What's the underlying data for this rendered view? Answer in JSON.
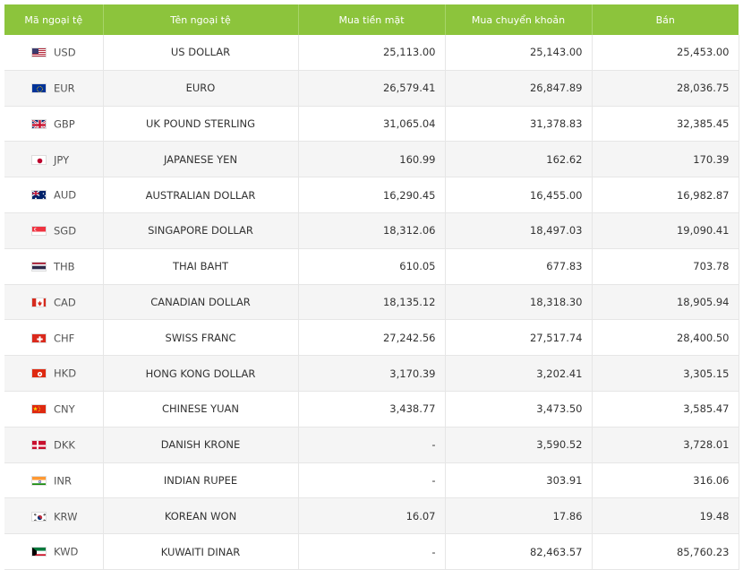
{
  "headers": [
    "Mã ngoại tệ",
    "Tên ngoại tệ",
    "Mua tiền mặt",
    "Mua chuyển khoản",
    "Bán"
  ],
  "rows": [
    {
      "code": "USD",
      "name": "US DOLLAR",
      "cash": "25,113.00",
      "transfer": "25,143.00",
      "sell": "25,453.00",
      "flag": "us-flag-icon"
    },
    {
      "code": "EUR",
      "name": "EURO",
      "cash": "26,579.41",
      "transfer": "26,847.89",
      "sell": "28,036.75",
      "flag": "eu-flag-icon"
    },
    {
      "code": "GBP",
      "name": "UK POUND STERLING",
      "cash": "31,065.04",
      "transfer": "31,378.83",
      "sell": "32,385.45",
      "flag": "uk-flag-icon"
    },
    {
      "code": "JPY",
      "name": "JAPANESE YEN",
      "cash": "160.99",
      "transfer": "162.62",
      "sell": "170.39",
      "flag": "jp-flag-icon"
    },
    {
      "code": "AUD",
      "name": "AUSTRALIAN DOLLAR",
      "cash": "16,290.45",
      "transfer": "16,455.00",
      "sell": "16,982.87",
      "flag": "au-flag-icon"
    },
    {
      "code": "SGD",
      "name": "SINGAPORE DOLLAR",
      "cash": "18,312.06",
      "transfer": "18,497.03",
      "sell": "19,090.41",
      "flag": "sg-flag-icon"
    },
    {
      "code": "THB",
      "name": "THAI BAHT",
      "cash": "610.05",
      "transfer": "677.83",
      "sell": "703.78",
      "flag": "th-flag-icon"
    },
    {
      "code": "CAD",
      "name": "CANADIAN DOLLAR",
      "cash": "18,135.12",
      "transfer": "18,318.30",
      "sell": "18,905.94",
      "flag": "ca-flag-icon"
    },
    {
      "code": "CHF",
      "name": "SWISS FRANC",
      "cash": "27,242.56",
      "transfer": "27,517.74",
      "sell": "28,400.50",
      "flag": "ch-flag-icon"
    },
    {
      "code": "HKD",
      "name": "HONG KONG DOLLAR",
      "cash": "3,170.39",
      "transfer": "3,202.41",
      "sell": "3,305.15",
      "flag": "hk-flag-icon"
    },
    {
      "code": "CNY",
      "name": "CHINESE YUAN",
      "cash": "3,438.77",
      "transfer": "3,473.50",
      "sell": "3,585.47",
      "flag": "cn-flag-icon"
    },
    {
      "code": "DKK",
      "name": "DANISH KRONE",
      "cash": "-",
      "transfer": "3,590.52",
      "sell": "3,728.01",
      "flag": "dk-flag-icon"
    },
    {
      "code": "INR",
      "name": "INDIAN RUPEE",
      "cash": "-",
      "transfer": "303.91",
      "sell": "316.06",
      "flag": "in-flag-icon"
    },
    {
      "code": "KRW",
      "name": "KOREAN WON",
      "cash": "16.07",
      "transfer": "17.86",
      "sell": "19.48",
      "flag": "kr-flag-icon"
    },
    {
      "code": "KWD",
      "name": "KUWAITI DINAR",
      "cash": "-",
      "transfer": "82,463.57",
      "sell": "85,760.23",
      "flag": "kw-flag-icon"
    }
  ],
  "colors": {
    "header_bg": "#8cc43c",
    "header_text": "#ffffff",
    "stripe": "#f5f5f5",
    "border": "#e6e6e6"
  }
}
